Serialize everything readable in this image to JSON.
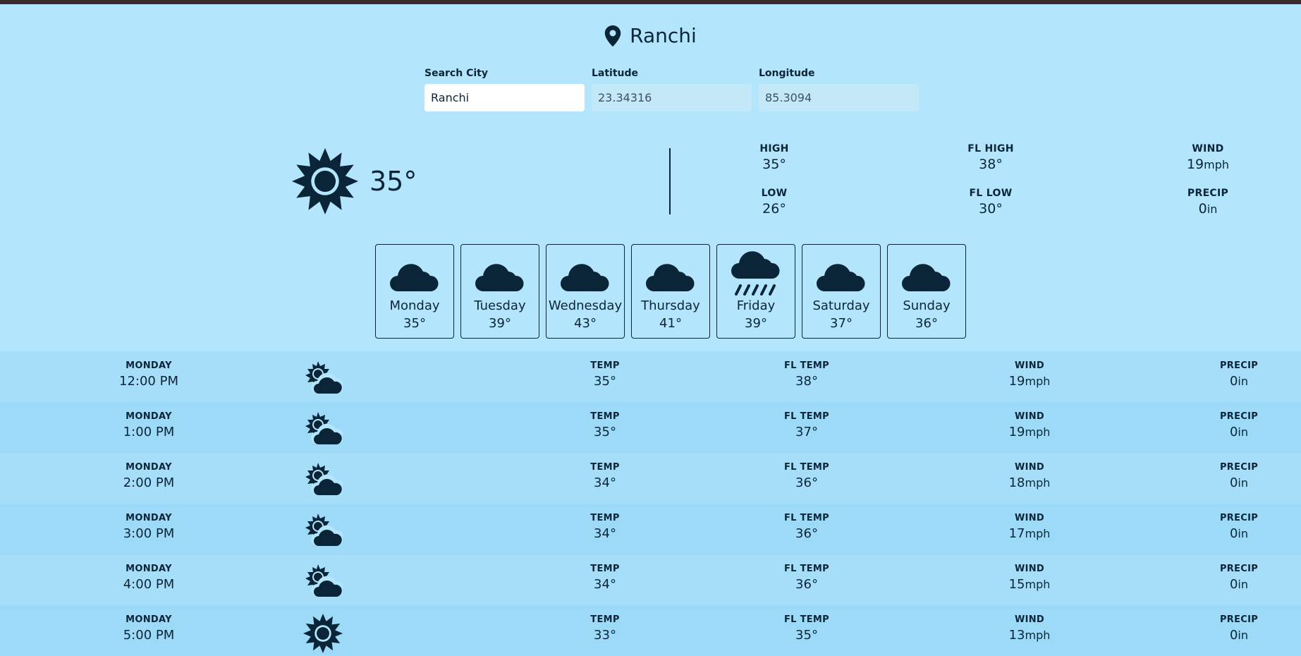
{
  "location": {
    "city": "Ranchi",
    "icon": "map-pin-icon"
  },
  "search": {
    "city_label": "Search City",
    "city_value": "Ranchi",
    "lat_label": "Latitude",
    "lat_value": "23.34316",
    "lon_label": "Longitude",
    "lon_value": "85.3094"
  },
  "current": {
    "icon": "sun-icon",
    "temp": "35°",
    "high_label": "HIGH",
    "high": "35°",
    "low_label": "LOW",
    "low": "26°",
    "fl_high_label": "FL HIGH",
    "fl_high": "38°",
    "fl_low_label": "FL LOW",
    "fl_low": "30°",
    "wind_label": "WIND",
    "wind": "19",
    "wind_unit": "mph",
    "precip_label": "PRECIP",
    "precip": "0",
    "precip_unit": "in"
  },
  "week": [
    {
      "name": "Monday",
      "temp": "35°",
      "icon": "cloud-icon"
    },
    {
      "name": "Tuesday",
      "temp": "39°",
      "icon": "cloud-icon"
    },
    {
      "name": "Wednesday",
      "temp": "43°",
      "icon": "cloud-icon"
    },
    {
      "name": "Thursday",
      "temp": "41°",
      "icon": "cloud-icon"
    },
    {
      "name": "Friday",
      "temp": "39°",
      "icon": "rain-icon"
    },
    {
      "name": "Saturday",
      "temp": "37°",
      "icon": "cloud-icon"
    },
    {
      "name": "Sunday",
      "temp": "36°",
      "icon": "cloud-icon"
    }
  ],
  "hourly_labels": {
    "temp": "TEMP",
    "fl_temp": "FL TEMP",
    "wind": "WIND",
    "precip": "PRECIP",
    "wind_unit": "mph",
    "precip_unit": "in"
  },
  "hourly": [
    {
      "day": "MONDAY",
      "time": "12:00 PM",
      "icon": "partly-cloudy-icon",
      "temp": "35°",
      "fl_temp": "38°",
      "wind": "19",
      "precip": "0"
    },
    {
      "day": "MONDAY",
      "time": "1:00 PM",
      "icon": "partly-cloudy-icon",
      "temp": "35°",
      "fl_temp": "37°",
      "wind": "19",
      "precip": "0"
    },
    {
      "day": "MONDAY",
      "time": "2:00 PM",
      "icon": "partly-cloudy-icon",
      "temp": "34°",
      "fl_temp": "36°",
      "wind": "18",
      "precip": "0"
    },
    {
      "day": "MONDAY",
      "time": "3:00 PM",
      "icon": "partly-cloudy-icon",
      "temp": "34°",
      "fl_temp": "36°",
      "wind": "17",
      "precip": "0"
    },
    {
      "day": "MONDAY",
      "time": "4:00 PM",
      "icon": "partly-cloudy-icon",
      "temp": "34°",
      "fl_temp": "36°",
      "wind": "15",
      "precip": "0"
    },
    {
      "day": "MONDAY",
      "time": "5:00 PM",
      "icon": "sun-icon",
      "temp": "33°",
      "fl_temp": "35°",
      "wind": "13",
      "precip": "0"
    }
  ],
  "colors": {
    "background": "#b3e5fc",
    "row_alt": "#9ddaf7",
    "row": "#a6def9",
    "ink": "#0b2538",
    "topbar": "#3b2a2d"
  }
}
